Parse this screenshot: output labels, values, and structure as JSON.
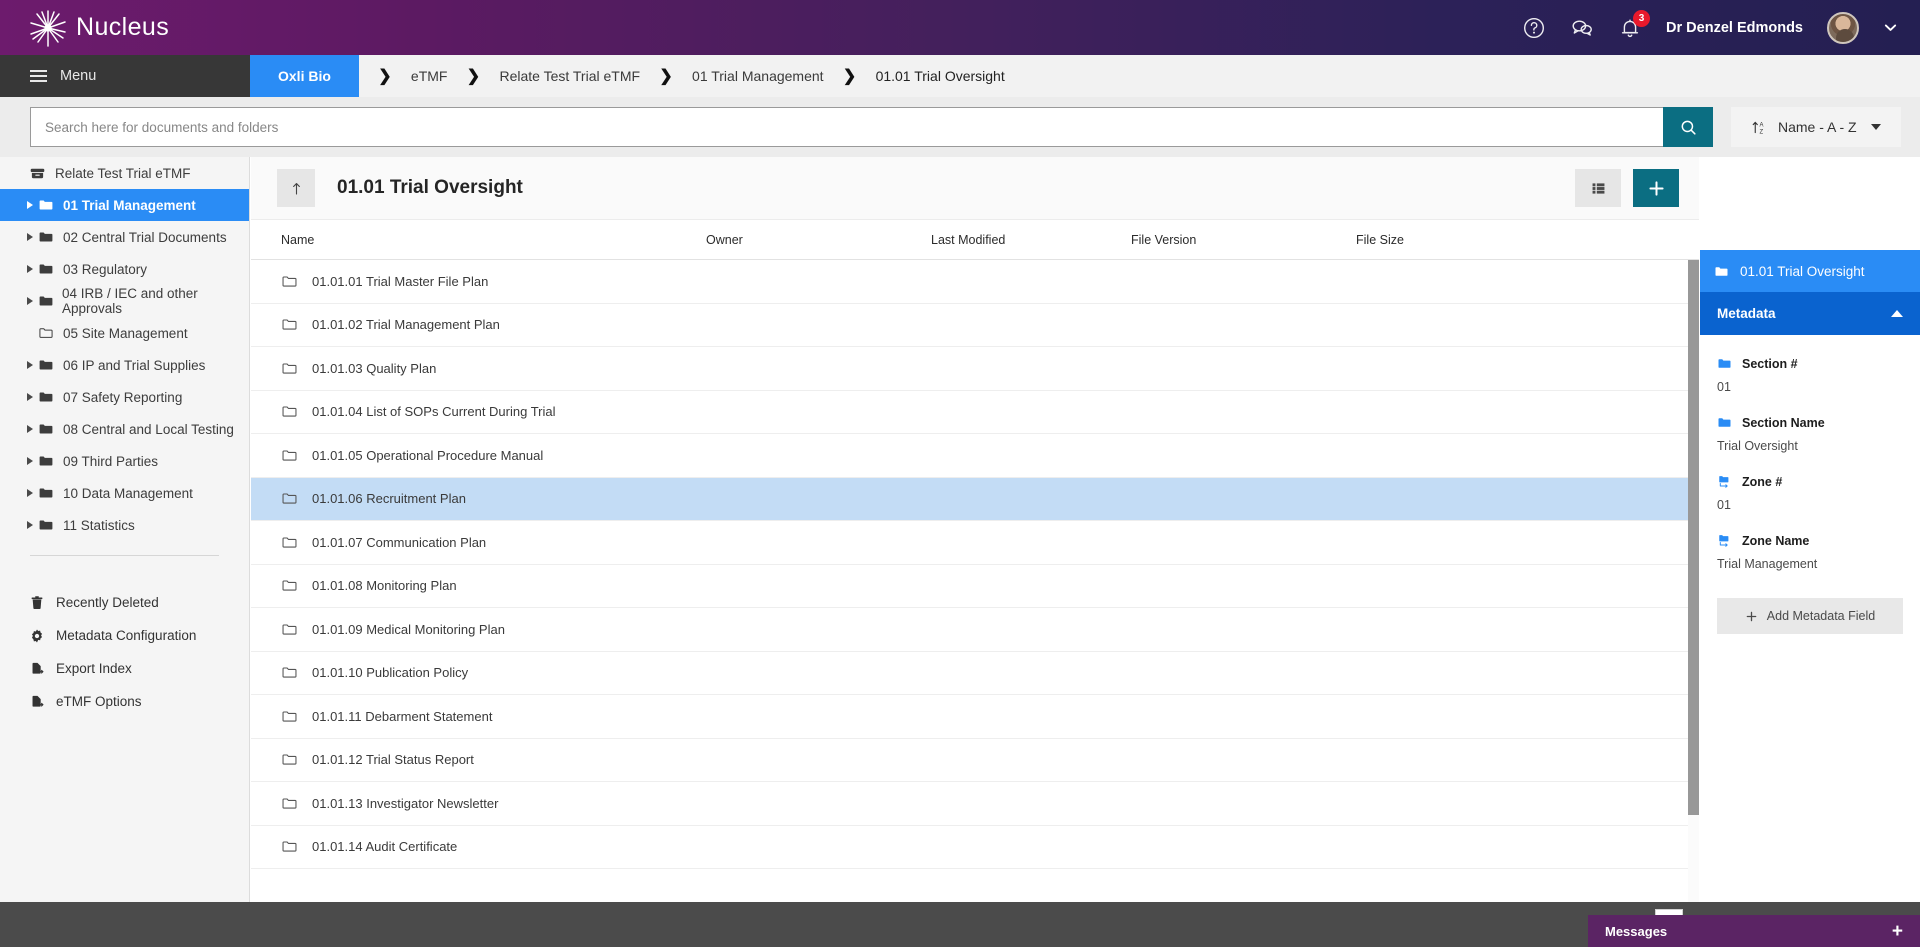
{
  "brand": {
    "name": "Nucleus",
    "logo_icon": "starburst-logo-icon",
    "help_icon": "help-circle-icon",
    "chat_icon": "chat-bubbles-icon",
    "bell_icon": "bell-icon",
    "notification_count": "3",
    "username": "Dr Denzel Edmonds",
    "avatar_icon": "user-avatar",
    "caret_icon": "chevron-down-icon",
    "gradient_start": "#6d1b6d",
    "gradient_end": "#241f52"
  },
  "nav": {
    "menu_label": "Menu",
    "menu_icon": "hamburger-icon",
    "home_crumb": "Oxli Bio",
    "separator_icon": "chevron-right-icon",
    "breadcrumbs": [
      {
        "label": "eTMF"
      },
      {
        "label": "Relate Test Trial eTMF"
      },
      {
        "label": "01 Trial Management"
      },
      {
        "label": "01.01 Trial Oversight"
      }
    ]
  },
  "search": {
    "placeholder": "Search here for documents and folders",
    "value": "",
    "button_icon": "search-icon",
    "button_color": "#0b6e82",
    "sort_label": "Name - A - Z",
    "sort_icon": "sort-az-icon"
  },
  "sidebar": {
    "root": {
      "label": "Relate Test Trial eTMF",
      "icon": "archive-icon"
    },
    "items": [
      {
        "label": "01 Trial Management",
        "icon": "folder-icon",
        "expandable": true,
        "selected": true
      },
      {
        "label": "02 Central Trial Documents",
        "icon": "folder-icon",
        "expandable": true,
        "selected": false
      },
      {
        "label": "03 Regulatory",
        "icon": "folder-icon",
        "expandable": true,
        "selected": false
      },
      {
        "label": "04 IRB / IEC and other Approvals",
        "icon": "folder-icon",
        "expandable": true,
        "selected": false
      },
      {
        "label": "05 Site Management",
        "icon": "folder-outline-icon",
        "expandable": false,
        "selected": false
      },
      {
        "label": "06 IP and Trial Supplies",
        "icon": "folder-icon",
        "expandable": true,
        "selected": false
      },
      {
        "label": "07 Safety Reporting",
        "icon": "folder-icon",
        "expandable": true,
        "selected": false
      },
      {
        "label": "08 Central and Local Testing",
        "icon": "folder-icon",
        "expandable": true,
        "selected": false
      },
      {
        "label": "09 Third Parties",
        "icon": "folder-icon",
        "expandable": true,
        "selected": false
      },
      {
        "label": "10 Data Management",
        "icon": "folder-icon",
        "expandable": true,
        "selected": false
      },
      {
        "label": "11 Statistics",
        "icon": "folder-icon",
        "expandable": true,
        "selected": false
      }
    ],
    "links": [
      {
        "label": "Recently Deleted",
        "icon": "trash-icon"
      },
      {
        "label": "Metadata Configuration",
        "icon": "gear-icon"
      },
      {
        "label": "Export Index",
        "icon": "file-export-icon"
      },
      {
        "label": "eTMF Options",
        "icon": "file-export-icon"
      }
    ]
  },
  "main": {
    "up_icon": "arrow-up-icon",
    "title": "01.01 Trial Oversight",
    "view_icon": "list-view-icon",
    "add_icon": "plus-icon",
    "add_color": "#0b6e82",
    "columns": [
      "Name",
      "Owner",
      "Last Modified",
      "File Version",
      "File Size"
    ],
    "rows": [
      {
        "name": "01.01.01 Trial Master File Plan",
        "owner": "",
        "modified": "",
        "version": "",
        "size": "",
        "icon": "folder-outline-icon",
        "selected": false
      },
      {
        "name": "01.01.02 Trial Management Plan",
        "owner": "",
        "modified": "",
        "version": "",
        "size": "",
        "icon": "folder-outline-icon",
        "selected": false
      },
      {
        "name": "01.01.03 Quality Plan",
        "owner": "",
        "modified": "",
        "version": "",
        "size": "",
        "icon": "folder-outline-icon",
        "selected": false
      },
      {
        "name": "01.01.04 List of SOPs Current During Trial",
        "owner": "",
        "modified": "",
        "version": "",
        "size": "",
        "icon": "folder-outline-icon",
        "selected": false
      },
      {
        "name": "01.01.05 Operational Procedure Manual",
        "owner": "",
        "modified": "",
        "version": "",
        "size": "",
        "icon": "folder-outline-icon",
        "selected": false
      },
      {
        "name": "01.01.06 Recruitment Plan",
        "owner": "",
        "modified": "",
        "version": "",
        "size": "",
        "icon": "folder-outline-icon",
        "selected": true
      },
      {
        "name": "01.01.07 Communication Plan",
        "owner": "",
        "modified": "",
        "version": "",
        "size": "",
        "icon": "folder-outline-icon",
        "selected": false
      },
      {
        "name": "01.01.08 Monitoring Plan",
        "owner": "",
        "modified": "",
        "version": "",
        "size": "",
        "icon": "folder-outline-icon",
        "selected": false
      },
      {
        "name": "01.01.09 Medical Monitoring Plan",
        "owner": "",
        "modified": "",
        "version": "",
        "size": "",
        "icon": "folder-outline-icon",
        "selected": false
      },
      {
        "name": "01.01.10 Publication Policy",
        "owner": "",
        "modified": "",
        "version": "",
        "size": "",
        "icon": "folder-outline-icon",
        "selected": false
      },
      {
        "name": "01.01.11 Debarment Statement",
        "owner": "",
        "modified": "",
        "version": "",
        "size": "",
        "icon": "folder-outline-icon",
        "selected": false
      },
      {
        "name": "01.01.12 Trial Status Report",
        "owner": "",
        "modified": "",
        "version": "",
        "size": "",
        "icon": "folder-outline-icon",
        "selected": false
      },
      {
        "name": "01.01.13 Investigator Newsletter",
        "owner": "",
        "modified": "",
        "version": "",
        "size": "",
        "icon": "folder-outline-icon",
        "selected": false
      },
      {
        "name": "01.01.14 Audit Certificate",
        "owner": "",
        "modified": "",
        "version": "",
        "size": "",
        "icon": "folder-outline-icon",
        "selected": false
      }
    ]
  },
  "metadata": {
    "title": "01.01 Trial Oversight",
    "title_icon": "folder-icon",
    "section_label": "Metadata",
    "collapse_icon": "chevron-up-icon",
    "fields": [
      {
        "label": "Section #",
        "value": "01",
        "icon": "folder-icon"
      },
      {
        "label": "Section Name",
        "value": "Trial Oversight",
        "icon": "folder-icon"
      },
      {
        "label": "Zone #",
        "value": "01",
        "icon": "folder-move-icon"
      },
      {
        "label": "Zone Name",
        "value": "Trial Management",
        "icon": "folder-move-icon"
      }
    ],
    "add_field_label": "Add Metadata Field",
    "add_field_icon": "plus-icon"
  },
  "footer": {
    "messages_label": "Messages",
    "messages_plus_icon": "plus-icon",
    "messages_color": "#5b2464"
  }
}
